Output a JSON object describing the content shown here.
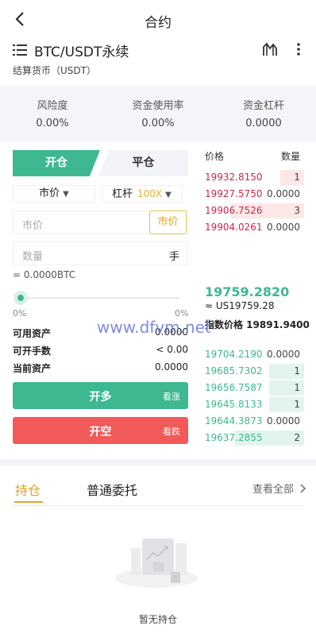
{
  "header": {
    "title": "合约"
  },
  "pair": {
    "name": "BTC/USDT永续",
    "settle_label": "结算货币（USDT）"
  },
  "stats": [
    {
      "label": "风险度",
      "value": "0.00%"
    },
    {
      "label": "资金使用率",
      "value": "0.00%"
    },
    {
      "label": "资金杠杆",
      "value": "0.0000"
    }
  ],
  "trade_tabs": {
    "open": "开仓",
    "close": "平仓"
  },
  "order_type": {
    "selected": "市价"
  },
  "leverage": {
    "label": "杠杆",
    "value": "100X"
  },
  "price_input": {
    "placeholder": "市价",
    "market_button": "市价"
  },
  "qty_input": {
    "placeholder": "数量",
    "unit": "手"
  },
  "btc_amount": "= 0.0000BTC",
  "slider": {
    "min_label": "0%",
    "max_label": "0%",
    "value_percent": 0
  },
  "info": [
    {
      "label": "可用资产",
      "value": "0.0000"
    },
    {
      "label": "可开手数",
      "value": "< 0.00"
    },
    {
      "label": "当前资产",
      "value": "0.0000"
    }
  ],
  "buttons": {
    "long": {
      "label": "开多",
      "sub": "看涨"
    },
    "short": {
      "label": "开空",
      "sub": "看跌"
    }
  },
  "orderbook": {
    "price_header": "价格",
    "qty_header": "数量",
    "asks": [
      {
        "price": "19932.8150",
        "qty": "1"
      },
      {
        "price": "19927.5750",
        "qty": "0.0000"
      },
      {
        "price": "19906.7526",
        "qty": "3"
      },
      {
        "price": "19904.0261",
        "qty": "0.0000"
      }
    ],
    "last_price": "19759.2820",
    "usd_price": "≈ US19759.28",
    "index_price": "指数价格 19891.9400",
    "bids": [
      {
        "price": "19704.2190",
        "qty": "0.0000"
      },
      {
        "price": "19685.7302",
        "qty": "1"
      },
      {
        "price": "19656.7587",
        "qty": "1"
      },
      {
        "price": "19645.8133",
        "qty": "1"
      },
      {
        "price": "19644.3873",
        "qty": "0.0000"
      },
      {
        "price": "19637.2855",
        "qty": "2"
      }
    ]
  },
  "bottom_tabs": {
    "positions": "持仓",
    "orders": "普通委托",
    "view_all": "查看全部"
  },
  "empty": {
    "text": "暂无持仓"
  },
  "watermark": "www.dfvm.net",
  "colors": {
    "green": "#3db891",
    "red": "#f25a5a",
    "gold": "#e2a424",
    "ask_text": "#c8284b"
  }
}
